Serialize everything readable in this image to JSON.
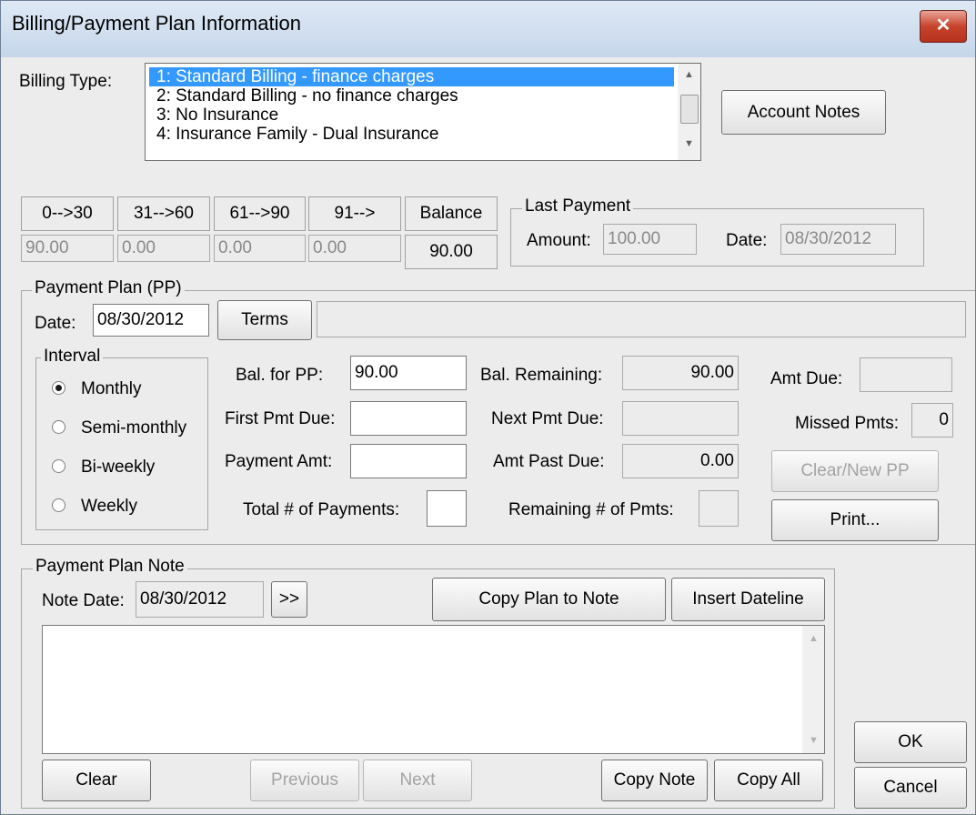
{
  "window": {
    "title": "Billing/Payment Plan Information",
    "close_glyph": "✕"
  },
  "billing": {
    "label": "Billing Type:",
    "options": [
      {
        "text": "1: Standard Billing - finance charges",
        "selected": true
      },
      {
        "text": "2: Standard Billing - no finance charges",
        "selected": false
      },
      {
        "text": "3: No Insurance",
        "selected": false
      },
      {
        "text": "4: Insurance Family - Dual Insurance",
        "selected": false
      }
    ],
    "account_notes_button": "Account Notes"
  },
  "aging": {
    "headers": [
      "0-->30",
      "31-->60",
      "61-->90",
      "91-->",
      "Balance"
    ],
    "values": [
      "90.00",
      "0.00",
      "0.00",
      "0.00",
      "90.00"
    ]
  },
  "last_payment": {
    "title": "Last Payment",
    "amount_label": "Amount:",
    "amount": "100.00",
    "date_label": "Date:",
    "date": "08/30/2012"
  },
  "payment_plan": {
    "title": "Payment Plan (PP)",
    "date_label": "Date:",
    "date": "08/30/2012",
    "terms_button": "Terms",
    "terms_text": "",
    "interval": {
      "title": "Interval",
      "options": [
        "Monthly",
        "Semi-monthly",
        "Bi-weekly",
        "Weekly"
      ],
      "selected": "Monthly"
    },
    "bal_for_pp_label": "Bal. for PP:",
    "bal_for_pp": "90.00",
    "first_pmt_due_label": "First Pmt Due:",
    "first_pmt_due": "",
    "payment_amt_label": "Payment Amt:",
    "payment_amt": "",
    "total_payments_label": "Total # of Payments:",
    "total_payments": "",
    "bal_remaining_label": "Bal. Remaining:",
    "bal_remaining": "90.00",
    "next_pmt_due_label": "Next Pmt Due:",
    "next_pmt_due": "",
    "amt_past_due_label": "Amt Past Due:",
    "amt_past_due": "0.00",
    "remaining_pmts_label": "Remaining # of Pmts:",
    "remaining_pmts": "",
    "amt_due_label": "Amt Due:",
    "amt_due": "",
    "missed_pmts_label": "Missed Pmts:",
    "missed_pmts": "0",
    "clear_new_button": "Clear/New PP",
    "print_button": "Print..."
  },
  "note": {
    "title": "Payment Plan Note",
    "date_label": "Note Date:",
    "date": "08/30/2012",
    "advance_button": ">>",
    "copy_plan_button": "Copy Plan to Note",
    "insert_dateline_button": "Insert Dateline",
    "text": "",
    "clear_button": "Clear",
    "previous_button": "Previous",
    "next_button": "Next",
    "copy_note_button": "Copy Note",
    "copy_all_button": "Copy All"
  },
  "dialog": {
    "ok_button": "OK",
    "cancel_button": "Cancel"
  }
}
